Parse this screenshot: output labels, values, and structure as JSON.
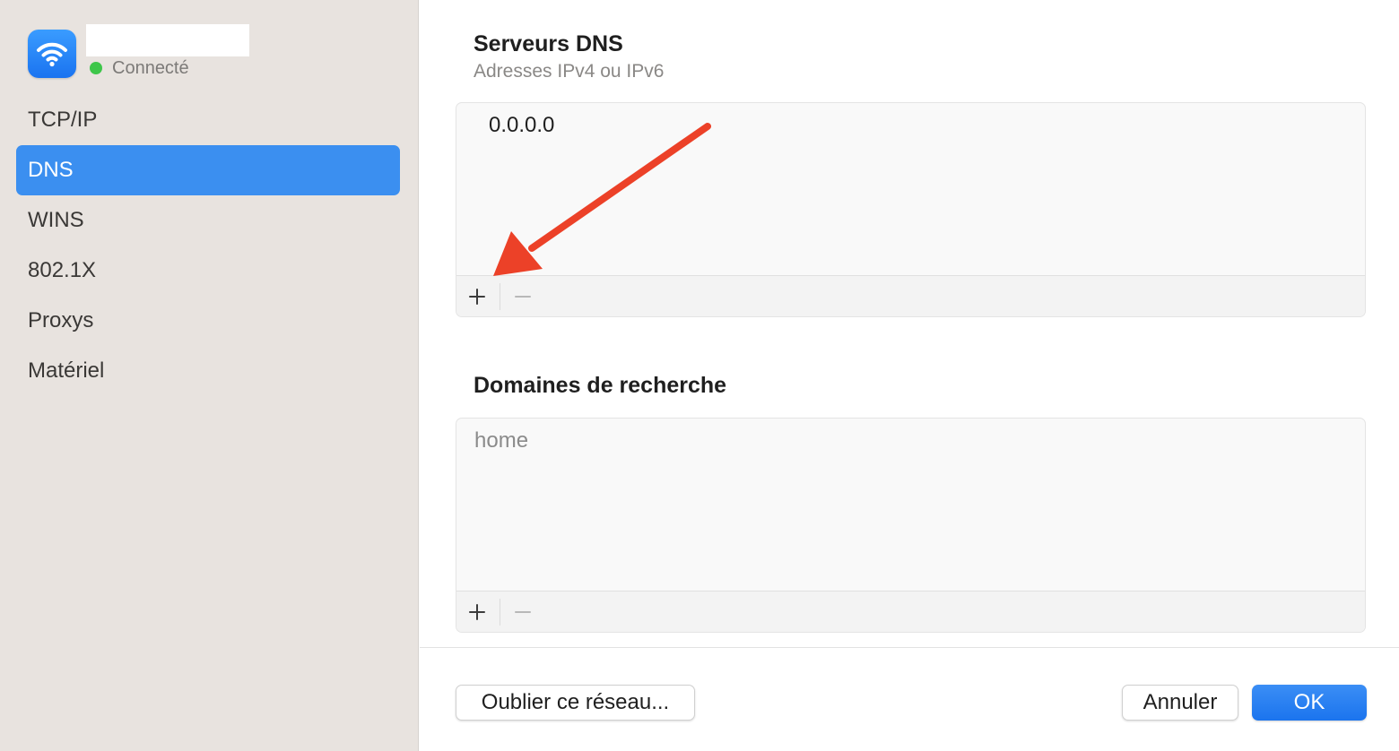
{
  "sidebar": {
    "network_icon": "wifi-icon",
    "status_label": "Connecté",
    "status_color": "#3ec64a",
    "items": [
      {
        "label": "TCP/IP",
        "active": false
      },
      {
        "label": "DNS",
        "active": true
      },
      {
        "label": "WINS",
        "active": false
      },
      {
        "label": "802.1X",
        "active": false
      },
      {
        "label": "Proxys",
        "active": false
      },
      {
        "label": "Matériel",
        "active": false
      }
    ]
  },
  "dns": {
    "title": "Serveurs DNS",
    "subtitle": "Adresses IPv4 ou IPv6",
    "servers": [
      "0.0.0.0"
    ],
    "add_icon": "plus-icon",
    "remove_icon": "minus-icon"
  },
  "search_domains": {
    "title": "Domaines de recherche",
    "entries": [
      "home"
    ],
    "add_icon": "plus-icon",
    "remove_icon": "minus-icon"
  },
  "footer": {
    "forget_label": "Oublier ce réseau...",
    "cancel_label": "Annuler",
    "ok_label": "OK"
  },
  "colors": {
    "accent": "#3b8ff0",
    "sidebar_bg": "#e8e3df",
    "annotation_arrow": "#ec4128"
  }
}
